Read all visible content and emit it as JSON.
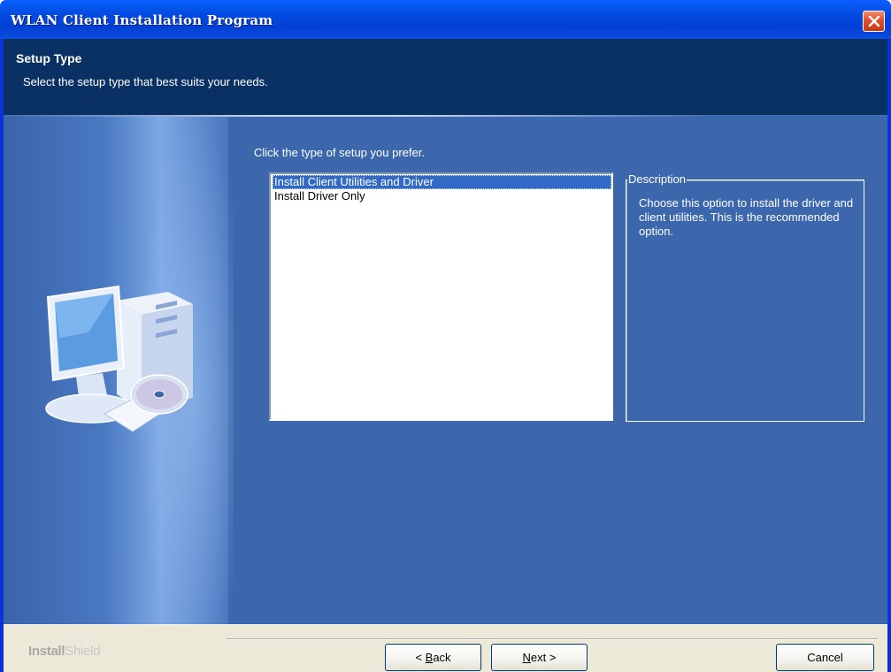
{
  "window": {
    "title": "WLAN Client Installation Program"
  },
  "header": {
    "title": "Setup Type",
    "subtitle": "Select the setup type that best suits your needs."
  },
  "main": {
    "prompt": "Click the type of setup you prefer.",
    "options": [
      {
        "label": "Install Client Utilities and Driver",
        "selected": true
      },
      {
        "label": "Install Driver Only",
        "selected": false
      }
    ],
    "description": {
      "legend": "Description",
      "text": "Choose this option to install the driver and client utilities. This is the recommended option."
    }
  },
  "footer": {
    "brand_part1": "Install",
    "brand_part2": "Shield",
    "back": {
      "prefix": "< ",
      "mnemonic": "B",
      "rest": "ack"
    },
    "next": {
      "mnemonic": "N",
      "rest": "ext",
      "suffix": " >"
    },
    "cancel": "Cancel"
  },
  "colors": {
    "titlebar": "#0349e0",
    "header": "#0a3164",
    "panel": "#3c67ac",
    "selection": "#316ac5",
    "footer": "#ece9d8",
    "close": "#e0512f"
  },
  "icons": {
    "close": "close-icon",
    "illustration": "computer-with-cd-icon"
  }
}
